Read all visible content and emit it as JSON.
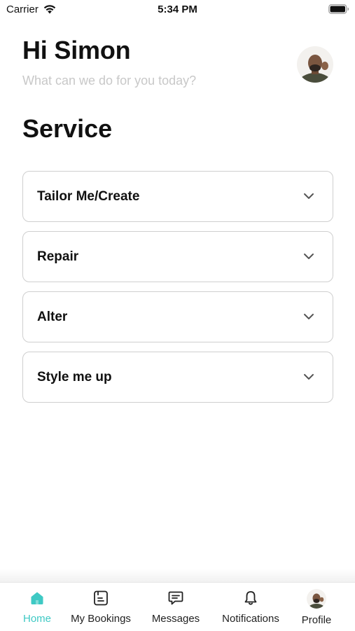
{
  "status_bar": {
    "carrier": "Carrier",
    "time": "5:34 PM"
  },
  "header": {
    "greeting": "Hi Simon",
    "subtitle": "What can we do for you today?",
    "avatar_icon": "user-avatar"
  },
  "section": {
    "title": "Service"
  },
  "services": [
    {
      "label": "Tailor Me/Create",
      "icon": "chevron-down-icon"
    },
    {
      "label": "Repair",
      "icon": "chevron-down-icon"
    },
    {
      "label": "Alter",
      "icon": "chevron-down-icon"
    },
    {
      "label": "Style me up",
      "icon": "chevron-down-icon"
    }
  ],
  "tabs": [
    {
      "label": "Home",
      "icon": "home-icon",
      "active": true
    },
    {
      "label": "My Bookings",
      "icon": "bookings-icon",
      "active": false
    },
    {
      "label": "Messages",
      "icon": "message-icon",
      "active": false
    },
    {
      "label": "Notifications",
      "icon": "bell-icon",
      "active": false
    },
    {
      "label": "Profile",
      "icon": "profile-avatar",
      "active": false
    }
  ],
  "colors": {
    "accent": "#3ec9c4",
    "subtitle": "#c8c8c8",
    "card_border": "#cfcfcf"
  }
}
